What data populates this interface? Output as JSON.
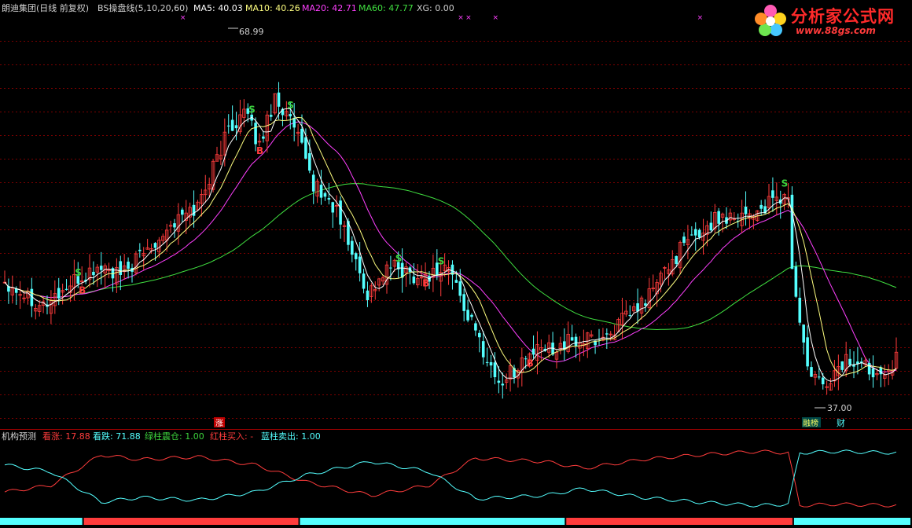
{
  "header": {
    "stock": "朗迪集团(日线 前复权)",
    "indicator": "BS操盘线(5,10,20,60)",
    "ma5": "MA5: 40.03",
    "ma10": "MA10: 40.26",
    "ma20": "MA20: 42.71",
    "ma60": "MA60: 47.77",
    "xg": "XG: 0.00"
  },
  "logo": {
    "brand": "分析家公式网",
    "url": "www.88gs.com"
  },
  "price_labels": {
    "high": "68.99",
    "low": "37.00"
  },
  "signal_labels": {
    "buy": "B",
    "sell": "S"
  },
  "markers": {
    "zhang": "涨",
    "badge1": "融榜",
    "badge2": "财"
  },
  "sub_header": {
    "title": "机构预测",
    "kanzhang": "看涨: 17.88",
    "kandie": "看跌: 71.88",
    "green": "绿柱震仓: 1.00",
    "red": "红柱买入: -",
    "blue": "蓝柱卖出: 1.00"
  },
  "colors": {
    "up": "#ff3c3c",
    "down": "#54ffff",
    "ma5": "#ffffff",
    "ma10": "#ffff80",
    "ma20": "#ff40ff",
    "ma60": "#40e040",
    "grid": "#7a0000",
    "green_text": "#3cd23c"
  },
  "chart_data": {
    "type": "candlestick",
    "price_range": [
      35.0,
      71.0
    ],
    "ticks": [
      {
        "i": 0,
        "c": 47.2
      },
      {
        "i": 10,
        "c": 45.0
      },
      {
        "i": 18,
        "c": 47.0
      },
      {
        "i": 25,
        "c": 48.5
      },
      {
        "i": 30,
        "c": 47.5
      },
      {
        "i": 34,
        "c": 49.0
      },
      {
        "i": 42,
        "c": 52.0
      },
      {
        "i": 50,
        "c": 54.0
      },
      {
        "i": 58,
        "c": 61.0
      },
      {
        "i": 62,
        "c": 62.5
      },
      {
        "i": 66,
        "c": 59.5
      },
      {
        "i": 70,
        "c": 64.0
      },
      {
        "i": 75,
        "c": 61.0
      },
      {
        "i": 80,
        "c": 56.0
      },
      {
        "i": 86,
        "c": 53.5
      },
      {
        "i": 94,
        "c": 46.0
      },
      {
        "i": 100,
        "c": 48.5
      },
      {
        "i": 108,
        "c": 47.5
      },
      {
        "i": 115,
        "c": 48.5
      },
      {
        "i": 120,
        "c": 44.0
      },
      {
        "i": 128,
        "c": 37.8
      },
      {
        "i": 136,
        "c": 40.5
      },
      {
        "i": 145,
        "c": 41.5
      },
      {
        "i": 155,
        "c": 42.0
      },
      {
        "i": 165,
        "c": 45.0
      },
      {
        "i": 175,
        "c": 50.0
      },
      {
        "i": 185,
        "c": 53.0
      },
      {
        "i": 195,
        "c": 53.5
      },
      {
        "i": 203,
        "c": 55.0
      },
      {
        "i": 204,
        "c": 48.0
      },
      {
        "i": 208,
        "c": 39.0
      },
      {
        "i": 212,
        "c": 37.5
      },
      {
        "i": 218,
        "c": 40.0
      },
      {
        "i": 226,
        "c": 39.0
      },
      {
        "i": 231,
        "c": 40.0
      }
    ],
    "ma_offsets": {
      "ma5": 0,
      "ma10": 1,
      "ma20": 3,
      "ma60": 8
    },
    "high": 68.99,
    "low": 37.0,
    "sub_range": [
      0,
      100
    ],
    "sub_red": [
      {
        "i": 0,
        "v": 30
      },
      {
        "i": 12,
        "v": 40
      },
      {
        "i": 25,
        "v": 85
      },
      {
        "i": 35,
        "v": 78
      },
      {
        "i": 50,
        "v": 82
      },
      {
        "i": 65,
        "v": 70
      },
      {
        "i": 78,
        "v": 45
      },
      {
        "i": 95,
        "v": 25
      },
      {
        "i": 110,
        "v": 40
      },
      {
        "i": 122,
        "v": 80
      },
      {
        "i": 140,
        "v": 75
      },
      {
        "i": 150,
        "v": 65
      },
      {
        "i": 165,
        "v": 78
      },
      {
        "i": 180,
        "v": 85
      },
      {
        "i": 195,
        "v": 90
      },
      {
        "i": 203,
        "v": 88
      },
      {
        "i": 206,
        "v": 10
      },
      {
        "i": 215,
        "v": 12
      },
      {
        "i": 231,
        "v": 10
      }
    ],
    "sub_blue": [
      {
        "i": 0,
        "v": 70
      },
      {
        "i": 12,
        "v": 60
      },
      {
        "i": 25,
        "v": 15
      },
      {
        "i": 35,
        "v": 22
      },
      {
        "i": 50,
        "v": 18
      },
      {
        "i": 65,
        "v": 30
      },
      {
        "i": 78,
        "v": 55
      },
      {
        "i": 95,
        "v": 75
      },
      {
        "i": 110,
        "v": 60
      },
      {
        "i": 122,
        "v": 20
      },
      {
        "i": 140,
        "v": 25
      },
      {
        "i": 150,
        "v": 35
      },
      {
        "i": 165,
        "v": 22
      },
      {
        "i": 180,
        "v": 15
      },
      {
        "i": 195,
        "v": 10
      },
      {
        "i": 203,
        "v": 12
      },
      {
        "i": 206,
        "v": 88
      },
      {
        "i": 215,
        "v": 90
      },
      {
        "i": 231,
        "v": 88
      }
    ],
    "bar_segments": [
      {
        "from": 0,
        "to": 21,
        "color": "down"
      },
      {
        "from": 21,
        "to": 77,
        "color": "up"
      },
      {
        "from": 77,
        "to": 146,
        "color": "down"
      },
      {
        "from": 146,
        "to": 205,
        "color": "up"
      },
      {
        "from": 205,
        "to": 232,
        "color": "down"
      }
    ],
    "buy_idx": [
      20,
      66,
      109,
      136
    ],
    "sell_idx": [
      19,
      64,
      74,
      102,
      113,
      202
    ],
    "x_marks": [
      46,
      118,
      120,
      127,
      180
    ]
  }
}
